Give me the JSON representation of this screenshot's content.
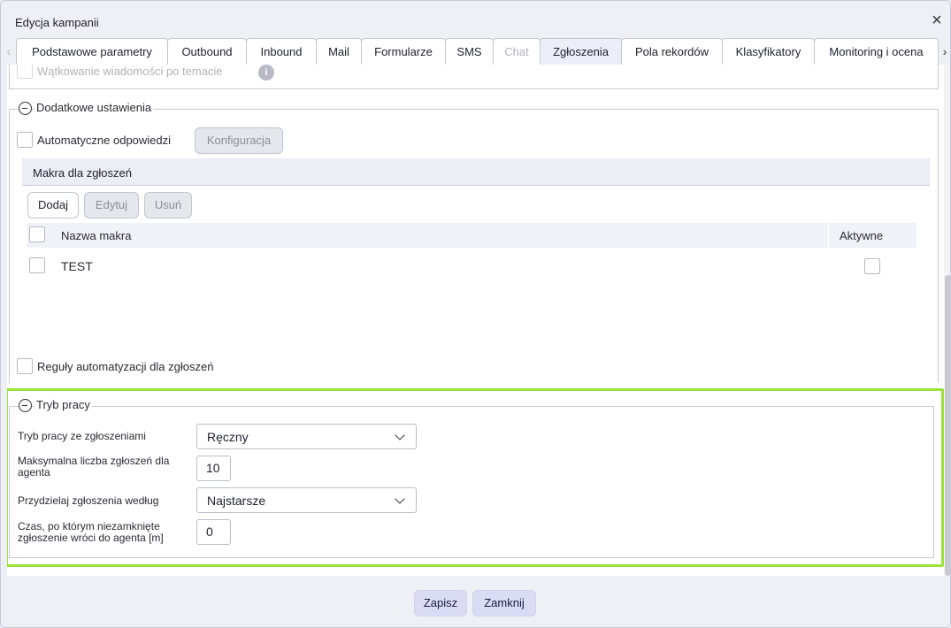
{
  "dialog": {
    "title": "Edycja kampanii",
    "close_label": "×"
  },
  "tabs": [
    {
      "label": "Podstawowe parametry",
      "state": "normal"
    },
    {
      "label": "Outbound",
      "state": "normal"
    },
    {
      "label": "Inbound",
      "state": "normal"
    },
    {
      "label": "Mail",
      "state": "normal"
    },
    {
      "label": "Formularze",
      "state": "normal"
    },
    {
      "label": "SMS",
      "state": "normal"
    },
    {
      "label": "Chat",
      "state": "disabled"
    },
    {
      "label": "Zgłoszenia",
      "state": "active"
    },
    {
      "label": "Pola rekordów",
      "state": "normal"
    },
    {
      "label": "Klasyfikatory",
      "state": "normal"
    },
    {
      "label": "Monitoring i ocena",
      "state": "normal"
    }
  ],
  "tab_arrows": {
    "left": "‹",
    "right": "›"
  },
  "threading": {
    "label": "Wątkowanie wiadomości po temacie",
    "checked": false,
    "info_icon": "i"
  },
  "additional": {
    "legend": "Dodatkowe ustawienia",
    "auto_replies": {
      "label": "Automatyczne odpowiedzi",
      "checked": false
    },
    "config_button": "Konfiguracja",
    "macros": {
      "header": "Makra dla zgłoszeń",
      "buttons": {
        "add": "Dodaj",
        "edit": "Edytuj",
        "delete": "Usuń"
      },
      "columns": {
        "name": "Nazwa makra",
        "active": "Aktywne"
      },
      "rows": [
        {
          "name": "TEST",
          "selected": false,
          "active": false
        }
      ]
    },
    "automation": {
      "label": "Reguły automatyzacji dla zgłoszeń",
      "checked": false
    }
  },
  "work_mode": {
    "legend": "Tryb pracy",
    "mode": {
      "label": "Tryb pracy ze zgłoszeniami",
      "value": "Ręczny"
    },
    "max_tickets": {
      "label": "Maksymalna liczba zgłoszeń dla agenta",
      "value": "10"
    },
    "assign_by": {
      "label": "Przydzielaj zgłoszenia według",
      "value": "Najstarsze"
    },
    "return_time": {
      "label": "Czas, po którym niezamknięte zgłoszenie wróci do agenta [m]",
      "value": "0"
    }
  },
  "footer": {
    "save": "Zapisz",
    "close": "Zamknij"
  },
  "colors": {
    "highlight": "#9be23a",
    "primary_button": "#d9dcf3"
  }
}
